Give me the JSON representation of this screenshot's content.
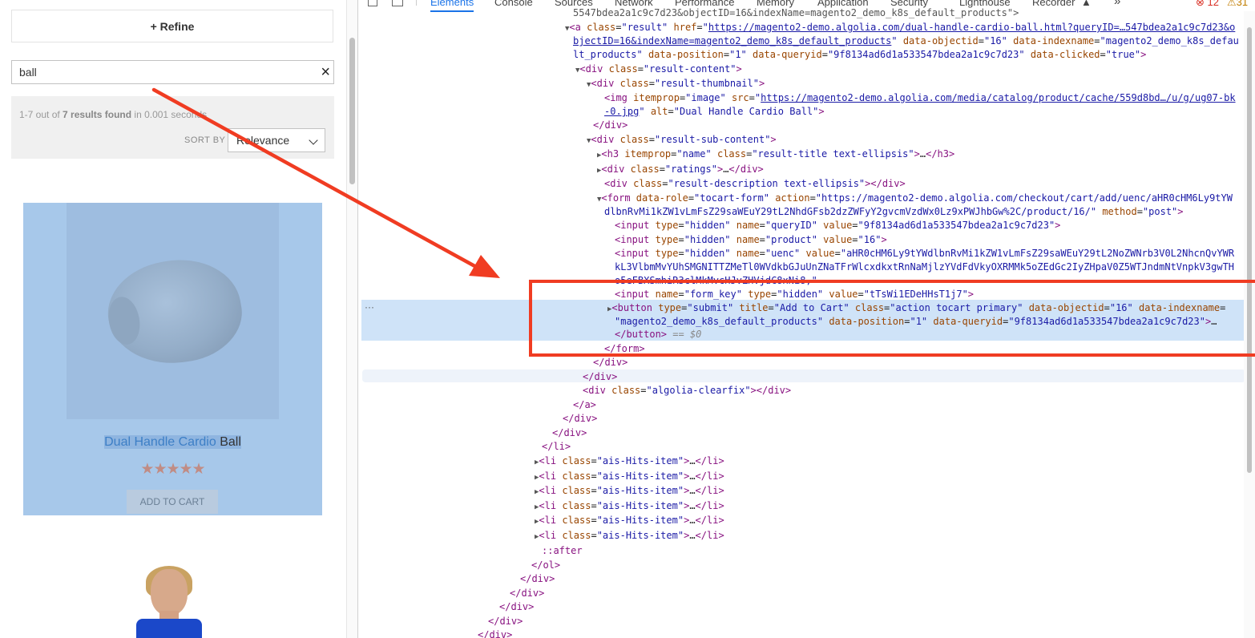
{
  "left_page": {
    "refine_label": "+ Refine",
    "search": {
      "value": "ball",
      "clear_icon": "×"
    },
    "stats": {
      "prefix": "1-7 out of ",
      "count": "7 results found",
      "suffix": " in 0.001 seconds"
    },
    "sort": {
      "label": "SORT BY",
      "value": "Relevance"
    },
    "hit": {
      "title_highlight": "Dual Handle Cardio",
      "title_rest": " Ball",
      "stars": "★★★★★",
      "button": "ADD TO CART"
    }
  },
  "devtools": {
    "tabs": [
      "Elements",
      "Console",
      "Sources",
      "Network",
      "Performance",
      "Memory",
      "Application",
      "Security",
      "Lighthouse",
      "Recorder"
    ],
    "active_tab": "Elements",
    "more": "»",
    "errors": "12",
    "warnings": "31",
    "dom": {
      "l0": "5547bdea2a1c9c7d23&objectID=16&indexName=magento2_demo_k8s_default_products\">",
      "l1_href": "https://magento2-demo.algolia.com/dual-handle-cardio-ball.html?queryID=…547bdea2a1c9c7d23&o",
      "l1b_href": "bjectID=16&indexName=magento2_demo_k8s_default_products",
      "l1_objectid": "\"16\"",
      "l1_indexname": "\"magento2_demo_k8s_defau",
      "l1c": "lt_products\"",
      "l1_position": "\"1\"",
      "l1_queryid": "\"9f8134ad6d1a533547bdea2a1c9c7d23\"",
      "l1_clicked": "\"true\"",
      "img_src": "https://magento2-demo.algolia.com/media/catalog/product/cache/559d8bd…/u/g/ug07-bk",
      "img_src2": "-0.jpg",
      "img_alt": "\"Dual Handle Cardio Ball\"",
      "form_action": "\"https://magento2-demo.algolia.com/checkout/cart/add/uenc/aHR0cHM6Ly9tYW",
      "form_action2": "dlbnRvMi1kZW1vLmFsZ29saWEuY29tL2NhdGFsb2dzZWFyY2gvcmVzdWx0Lz9xPWJhbGw%2C/product/16/\"",
      "queryid_value": "\"9f8134ad6d1a533547bdea2a1c9c7d23\"",
      "product_value": "\"16\"",
      "uenc_value": "\"aHR0cHM6Ly9tYWdlbnRvMi1kZW1vLmFsZ29saWEuY29tL2NoZWNrb3V0L2NhcnQvYWR",
      "uenc_value2": "kL3VlbmMvYUhSMGNITTZMeTl0WVdkbGJuUnZNaTFrWlcxdkxtRnNaMjlzYVdFdVkyOXRMMk5oZEdGc2IyZHpaV0Z5WTJndmNtVnpkV3gwTH",
      "uenc_value3": "o5eFBXSmhiR3clMkMvcHJvZHVjdC8xNi8,\"",
      "form_key_value": "\"tTsWi1EDeHHsT1j7\"",
      "btn_title": "\"Add to Cart\"",
      "btn_class": "\"action tocart primary\"",
      "btn_objectid": "\"16\"",
      "btn_indexname": "\"magento2_demo_k8s_default_products\"",
      "btn_position": "\"1\"",
      "btn_queryid": "\"9f8134ad6d1a533547bdea2a1c9c7d23\"",
      "dollar0": "== $0"
    }
  },
  "annotation_colors": {
    "arrow": "#f03c22",
    "box": "#f03c22"
  }
}
